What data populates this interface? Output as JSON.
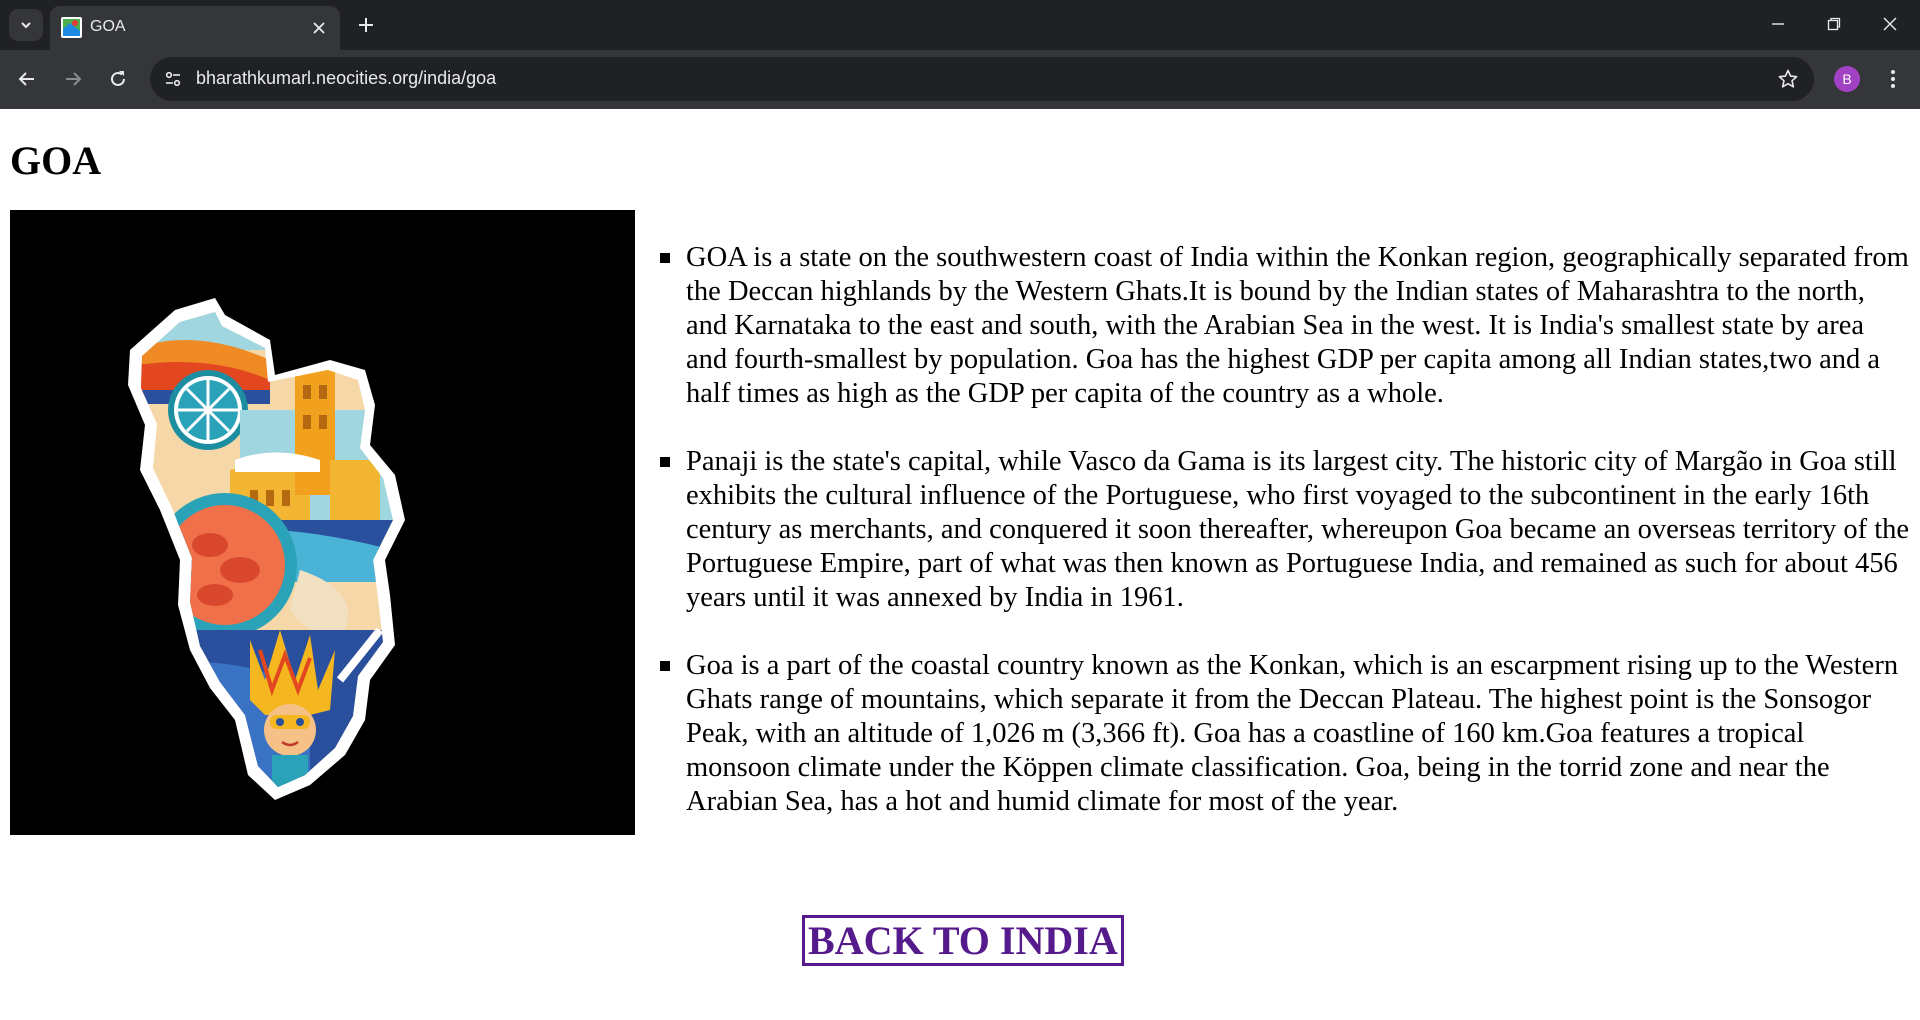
{
  "browser": {
    "tab_title": "GOA",
    "url": "bharathkumarl.neocities.org/india/goa",
    "avatar_letter": "B"
  },
  "page": {
    "heading": "GOA",
    "image_icon": "goa-map-illustration",
    "paragraphs": [
      "GOA is a state on the southwestern coast of India within the Konkan region, geographically separated from the Deccan highlands by the Western Ghats.It is bound by the Indian states of Maharashtra to the north, and Karnataka to the east and south, with the Arabian Sea in the west. It is India's smallest state by area and fourth-smallest by population. Goa has the highest GDP per capita among all Indian states,two and a half times as high as the GDP per capita of the country as a whole.",
      "Panaji is the state's capital, while Vasco da Gama is its largest city. The historic city of Margão in Goa still exhibits the cultural influence of the Portuguese, who first voyaged to the subcontinent in the early 16th century as merchants, and conquered it soon thereafter, whereupon Goa became an overseas territory of the Portuguese Empire, part of what was then known as Portuguese India, and remained as such for about 456 years until it was annexed by India in 1961.",
      "Goa is a part of the coastal country known as the Konkan, which is an escarpment rising up to the Western Ghats range of mountains, which separate it from the Deccan Plateau. The highest point is the Sonsogor Peak, with an altitude of 1,026 m (3,366 ft). Goa has a coastline of 160 km.Goa features a tropical monsoon climate under the Köppen climate classification. Goa, being in the torrid zone and near the Arabian Sea, has a hot and humid climate for most of the year."
    ],
    "back_link": "BACK TO INDIA"
  },
  "colors": {
    "link": "#551a8b",
    "chrome_dark": "#202124",
    "chrome_toolbar": "#35363a",
    "avatar": "#a142c4"
  }
}
